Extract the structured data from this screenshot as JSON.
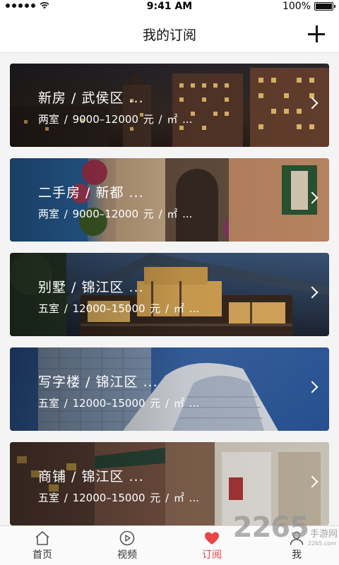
{
  "status_bar": {
    "time": "9:41 AM",
    "battery": "100%"
  },
  "header": {
    "title": "我的订阅"
  },
  "subscriptions": [
    {
      "title": "新房 / 武侯区 ...",
      "detail": "两室  /  9000–12000 元 / ㎡ ..."
    },
    {
      "title": "二手房 / 新都 ...",
      "detail": "两室  /  9000–12000 元 / ㎡ ..."
    },
    {
      "title": "别墅 / 锦江区 ...",
      "detail": "五室  /  12000–15000 元 / ㎡ ..."
    },
    {
      "title": "写字楼 / 锦江区 ...",
      "detail": "五室  /  12000–15000 元 / ㎡ ..."
    },
    {
      "title": "商铺 / 锦江区 ...",
      "detail": "五室  /  12000–15000 元 / ㎡ ..."
    }
  ],
  "tabs": [
    {
      "label": "首页",
      "icon": "home-icon"
    },
    {
      "label": "视频",
      "icon": "video-play-icon"
    },
    {
      "label": "订阅",
      "icon": "heart-icon"
    },
    {
      "label": "我",
      "icon": "person-icon"
    }
  ],
  "watermark": {
    "number": "2265",
    "text": "手游网",
    "url": "2265.com"
  },
  "colors": {
    "active_tab": "#e94545",
    "header_bg": "#ffffff",
    "page_bg": "#f4f4f4"
  }
}
